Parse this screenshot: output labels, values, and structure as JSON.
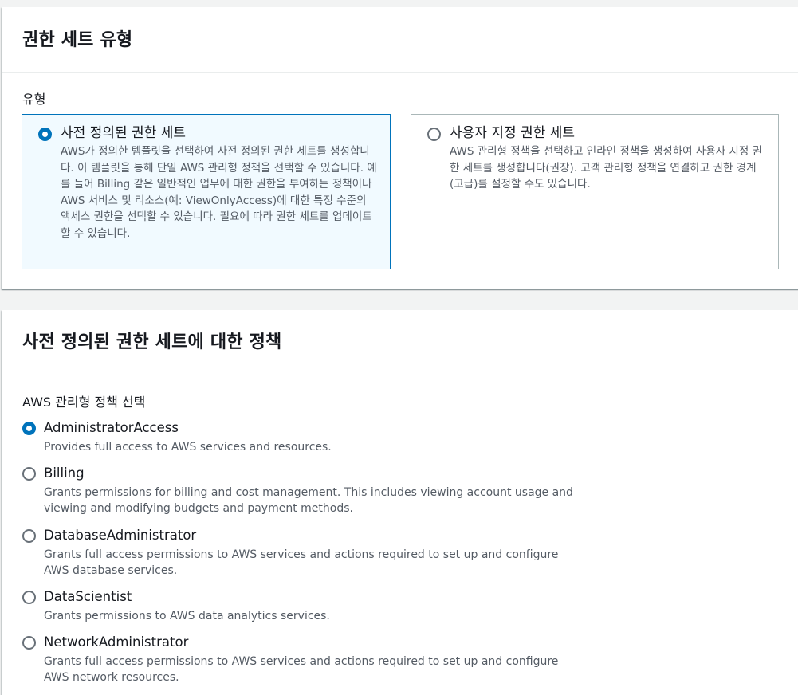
{
  "permission_set_type": {
    "title": "권한 세트 유형",
    "type_label": "유형",
    "options": [
      {
        "title": "사전 정의된 권한 세트",
        "description": "AWS가 정의한 템플릿을 선택하여 사전 정의된 권한 세트를 생성합니다. 이 템플릿을 통해 단일 AWS 관리형 정책을 선택할 수 있습니다. 예를 들어 Billing 같은 일반적인 업무에 대한 권한을 부여하는 정책이나 AWS 서비스 및 리소스(예: ViewOnlyAccess)에 대한 특정 수준의 액세스 권한을 선택할 수 있습니다. 필요에 따라 권한 세트를 업데이트할 수 있습니다.",
        "selected": true
      },
      {
        "title": "사용자 지정 권한 세트",
        "description": "AWS 관리형 정책을 선택하고 인라인 정책을 생성하여 사용자 지정 권한 세트를 생성합니다(권장). 고객 관리형 정책을 연결하고 권한 경계(고급)를 설정할 수도 있습니다.",
        "selected": false
      }
    ]
  },
  "policy_section": {
    "title": "사전 정의된 권한 세트에 대한 정책",
    "select_label": "AWS 관리형 정책 선택",
    "policies": [
      {
        "name": "AdministratorAccess",
        "description": "Provides full access to AWS services and resources.",
        "selected": true
      },
      {
        "name": "Billing",
        "description": "Grants permissions for billing and cost management. This includes viewing account usage and viewing and modifying budgets and payment methods.",
        "selected": false
      },
      {
        "name": "DatabaseAdministrator",
        "description": "Grants full access permissions to AWS services and actions required to set up and configure AWS database services.",
        "selected": false
      },
      {
        "name": "DataScientist",
        "description": "Grants permissions to AWS data analytics services.",
        "selected": false
      },
      {
        "name": "NetworkAdministrator",
        "description": "Grants full access permissions to AWS services and actions required to set up and configure AWS network resources.",
        "selected": false
      }
    ]
  },
  "colors": {
    "accent": "#0073bb",
    "selected_tile_bg": "#f1faff",
    "border": "#aab7b8",
    "secondary_text": "#545b64"
  }
}
